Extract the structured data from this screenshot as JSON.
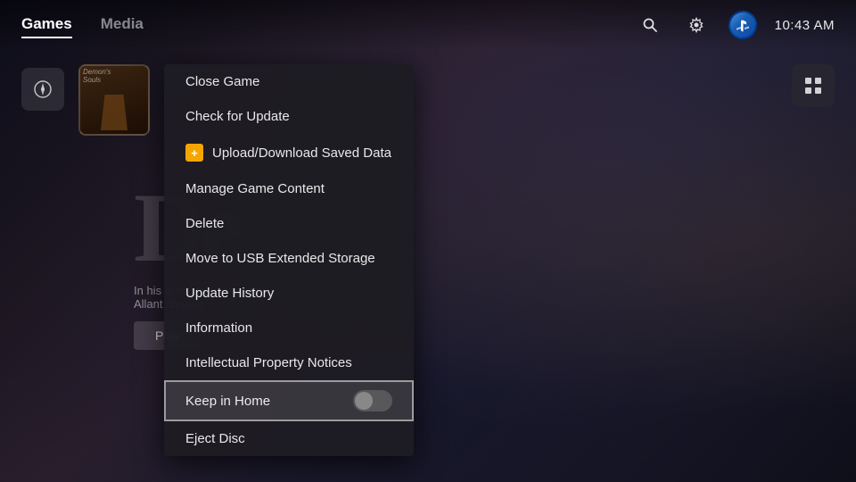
{
  "topbar": {
    "tabs": [
      {
        "label": "Games",
        "active": true
      },
      {
        "label": "Media",
        "active": false
      }
    ],
    "clock": "10:43 AM",
    "icons": {
      "search": "🔍",
      "settings": "⚙"
    }
  },
  "game": {
    "title": "Demon's Souls",
    "description_line1": "In his quest to reclaim the",
    "description_line2": "Allant channe",
    "play_label": "Play",
    "big_letters": "De"
  },
  "context_menu": {
    "items": [
      {
        "id": "close",
        "label": "Close Game",
        "icon": null,
        "type": "normal"
      },
      {
        "id": "check-update",
        "label": "Check for Update",
        "icon": null,
        "type": "normal"
      },
      {
        "id": "upload-download",
        "label": "Upload/Download Saved Data",
        "icon": "ps-plus",
        "type": "normal"
      },
      {
        "id": "manage-content",
        "label": "Manage Game Content",
        "icon": null,
        "type": "normal"
      },
      {
        "id": "delete",
        "label": "Delete",
        "icon": null,
        "type": "normal"
      },
      {
        "id": "move-usb",
        "label": "Move to USB Extended Storage",
        "icon": null,
        "type": "normal"
      },
      {
        "id": "update-history",
        "label": "Update History",
        "icon": null,
        "type": "normal"
      },
      {
        "id": "information",
        "label": "Information",
        "icon": null,
        "type": "normal"
      },
      {
        "id": "ip-notices",
        "label": "Intellectual Property Notices",
        "icon": null,
        "type": "normal"
      },
      {
        "id": "keep-home",
        "label": "Keep in Home",
        "icon": null,
        "type": "toggle",
        "toggle_value": false,
        "highlighted": true
      },
      {
        "id": "eject-disc",
        "label": "Eject Disc",
        "icon": null,
        "type": "normal"
      }
    ]
  }
}
